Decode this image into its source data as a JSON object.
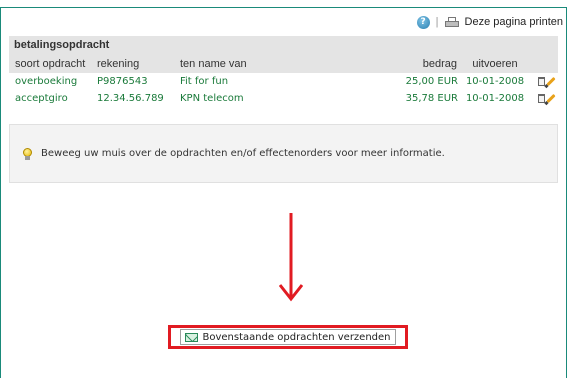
{
  "toolbar": {
    "help_icon": "help-icon",
    "separator": "|",
    "print_icon": "printer-icon",
    "print_label": "Deze pagina printen"
  },
  "panel": {
    "title": "betalingsopdracht",
    "columns": [
      "soort opdracht",
      "rekening",
      "ten name van",
      "bedrag",
      "uitvoeren"
    ],
    "rows": [
      {
        "soort": "overboeking",
        "rekening": "P9876543",
        "naam": "Fit for fun",
        "bedrag": "25,00 EUR",
        "uitvoeren": "10-01-2008"
      },
      {
        "soort": "acceptgiro",
        "rekening": "12.34.56.789",
        "naam": "KPN telecom",
        "bedrag": "35,78 EUR",
        "uitvoeren": "10-01-2008"
      }
    ]
  },
  "info": {
    "icon": "lightbulb-icon",
    "text": "Beweeg uw muis over de opdrachten en/of effectenorders voor meer informatie."
  },
  "send": {
    "icon": "mail-icon",
    "label": "Bovenstaande opdrachten verzenden"
  },
  "colors": {
    "frame": "#1a8a7a",
    "header_bg": "#e4e4e4",
    "row_text": "#1a7a3a",
    "highlight": "#e11b22"
  }
}
